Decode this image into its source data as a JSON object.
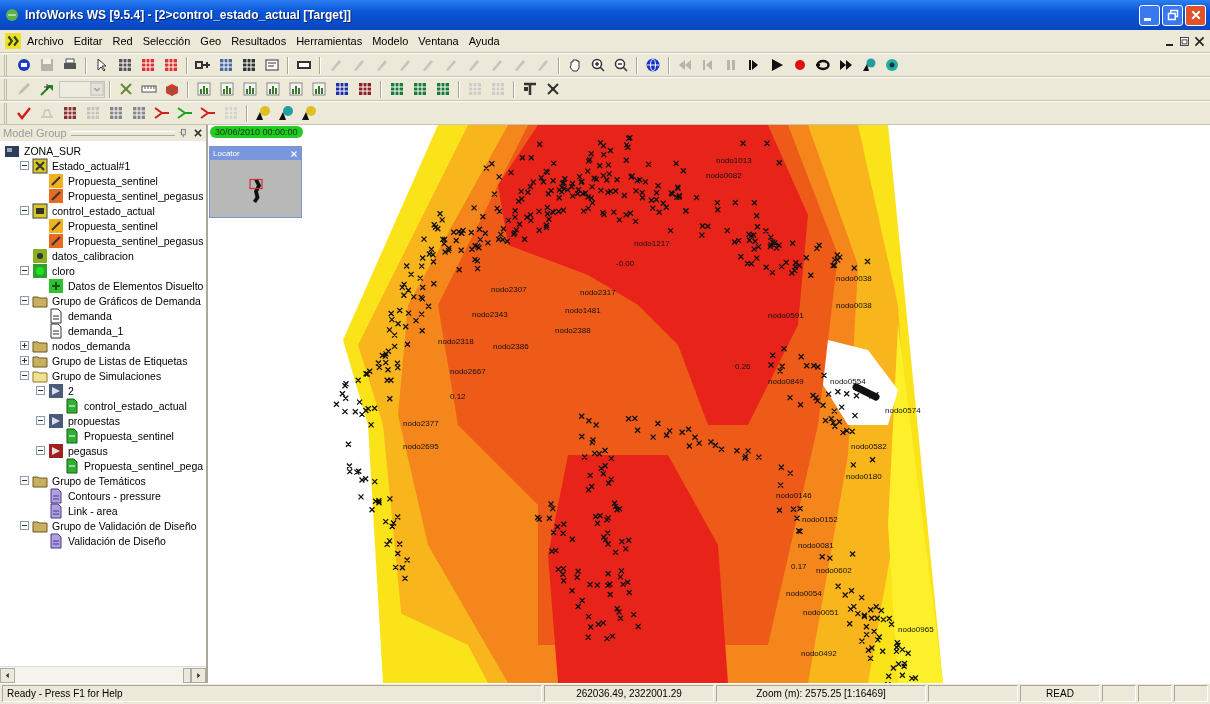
{
  "window": {
    "title": "InfoWorks WS [9.5.4] - [2>control_estado_actual [Target]]"
  },
  "menu": [
    {
      "label": "Archivo"
    },
    {
      "label": "Editar"
    },
    {
      "label": "Red"
    },
    {
      "label": "Selección"
    },
    {
      "label": "Geo"
    },
    {
      "label": "Resultados"
    },
    {
      "label": "Herramientas"
    },
    {
      "label": "Modelo"
    },
    {
      "label": "Ventana"
    },
    {
      "label": "Ayuda"
    }
  ],
  "toolbars": [
    {
      "buttons": [
        {
          "disabled": false
        },
        {
          "disabled": true
        },
        {
          "disabled": false
        },
        {
          "disabled": false
        },
        {
          "disabled": false
        },
        {
          "disabled": false
        },
        {
          "disabled": false
        },
        {
          "disabled": false
        },
        {
          "disabled": false
        },
        {
          "disabled": false
        },
        {
          "disabled": false
        },
        {
          "disabled": false
        },
        {
          "disabled": true
        },
        {
          "disabled": true
        },
        {
          "disabled": true
        },
        {
          "disabled": true
        },
        {
          "disabled": true
        },
        {
          "disabled": true
        },
        {
          "disabled": true
        },
        {
          "disabled": true
        },
        {
          "disabled": true
        },
        {
          "disabled": true
        },
        {
          "disabled": false
        },
        {
          "disabled": false
        },
        {
          "disabled": false
        },
        {
          "disabled": false
        },
        {
          "disabled": true
        },
        {
          "disabled": true
        },
        {
          "disabled": true
        },
        {
          "disabled": false
        },
        {
          "disabled": false
        },
        {
          "disabled": false
        },
        {
          "disabled": false
        },
        {
          "disabled": false
        },
        {
          "disabled": false
        },
        {
          "disabled": false
        }
      ]
    },
    {
      "buttons": [
        {
          "disabled": true
        },
        {
          "disabled": false
        },
        {
          "disabled": true
        },
        {
          "disabled": false
        },
        {
          "disabled": false
        },
        {
          "disabled": false
        },
        {
          "disabled": false
        },
        {
          "disabled": false
        },
        {
          "disabled": false
        },
        {
          "disabled": false
        },
        {
          "disabled": false
        },
        {
          "disabled": false
        },
        {
          "disabled": false
        },
        {
          "disabled": false
        },
        {
          "disabled": false
        },
        {
          "disabled": false
        },
        {
          "disabled": false
        },
        {
          "disabled": true
        },
        {
          "disabled": true
        },
        {
          "disabled": false
        },
        {
          "disabled": false
        }
      ]
    },
    {
      "buttons": [
        {
          "disabled": false
        },
        {
          "disabled": true
        },
        {
          "disabled": false
        },
        {
          "disabled": true
        },
        {
          "disabled": false
        },
        {
          "disabled": false
        },
        {
          "disabled": false
        },
        {
          "disabled": false
        },
        {
          "disabled": false
        },
        {
          "disabled": true
        },
        {
          "disabled": false
        },
        {
          "disabled": false
        },
        {
          "disabled": false
        }
      ]
    }
  ],
  "model_group": {
    "title": "Model Group",
    "items": [
      {
        "label": "ZONA_SUR",
        "kind": "model-group",
        "children": [
          {
            "label": "Estado_actual#1",
            "kind": "network",
            "expanded": true,
            "children": [
              {
                "label": "Propuesta_sentinel",
                "kind": "scenario"
              },
              {
                "label": "Propuesta_sentinel_pegasus",
                "kind": "scenario-alt"
              }
            ]
          },
          {
            "label": "control_estado_actual",
            "kind": "control",
            "expanded": true,
            "children": [
              {
                "label": "Propuesta_sentinel",
                "kind": "scenario"
              },
              {
                "label": "Propuesta_sentinel_pegasus",
                "kind": "scenario-alt"
              }
            ]
          },
          {
            "label": "datos_calibracion",
            "kind": "calibration"
          },
          {
            "label": "cloro",
            "kind": "pollutant",
            "expanded": true,
            "children": [
              {
                "label": "Datos de Elementos Disuelto",
                "kind": "data"
              }
            ]
          },
          {
            "label": "Grupo de Gráficos de Demanda",
            "kind": "folder",
            "expanded": true,
            "children": [
              {
                "label": "demanda",
                "kind": "document"
              },
              {
                "label": "demanda_1",
                "kind": "document"
              }
            ]
          },
          {
            "label": "nodos_demanda",
            "kind": "folder",
            "expanded": false
          },
          {
            "label": "Grupo de Listas de Etiquetas",
            "kind": "folder",
            "expanded": false
          },
          {
            "label": "Grupo de Simulaciones",
            "kind": "folder-open",
            "expanded": true,
            "children": [
              {
                "label": "2",
                "kind": "simulation",
                "expanded": true,
                "children": [
                  {
                    "label": "control_estado_actual",
                    "kind": "run"
                  }
                ]
              },
              {
                "label": "propuestas",
                "kind": "simulation",
                "expanded": true,
                "children": [
                  {
                    "label": "Propuesta_sentinel",
                    "kind": "run"
                  }
                ]
              },
              {
                "label": "pegasus",
                "kind": "simulation-failed",
                "expanded": true,
                "children": [
                  {
                    "label": "Propuesta_sentinel_pega",
                    "kind": "run"
                  }
                ]
              }
            ]
          },
          {
            "label": "Grupo de Temáticos",
            "kind": "folder",
            "expanded": true,
            "children": [
              {
                "label": "Contours - pressure",
                "kind": "theme"
              },
              {
                "label": "Link - area",
                "kind": "theme"
              }
            ]
          },
          {
            "label": "Grupo de Validación de Diseño",
            "kind": "folder",
            "expanded": true,
            "children": [
              {
                "label": "Validación de Diseño",
                "kind": "theme"
              }
            ]
          }
        ]
      }
    ]
  },
  "map": {
    "timestamp": "30/06/2010 00:00:00",
    "locator": {
      "title": "Locator"
    },
    "labels": [
      "nodo2307",
      "nodo2317",
      "nodo1481",
      "nodo2343",
      "nodo2388",
      "nodo2386",
      "nodo2318",
      "nodo2667",
      "0.12",
      "nodo2377",
      "nodo2695",
      "nodo1217",
      "-0.00",
      "nodo0038",
      "nodo0038",
      "nodo0591",
      "nodo0554",
      "0.26",
      "nodo0849",
      "nodo0574",
      "nodo0582",
      "nodo0180",
      "nodo0146",
      "nodo0152",
      "nodo0081",
      "0.17",
      "nodo0602",
      "nodo0054",
      "nodo0051",
      "nodo0965",
      "nodo0492",
      "nodo0082",
      "nodo1013"
    ]
  },
  "status_bar": {
    "message": "Ready - Press F1 for Help",
    "coordinates": "262036.49, 2322001.29",
    "zoom": "Zoom (m): 2575.25 [1:16469]",
    "mode": "READ"
  }
}
